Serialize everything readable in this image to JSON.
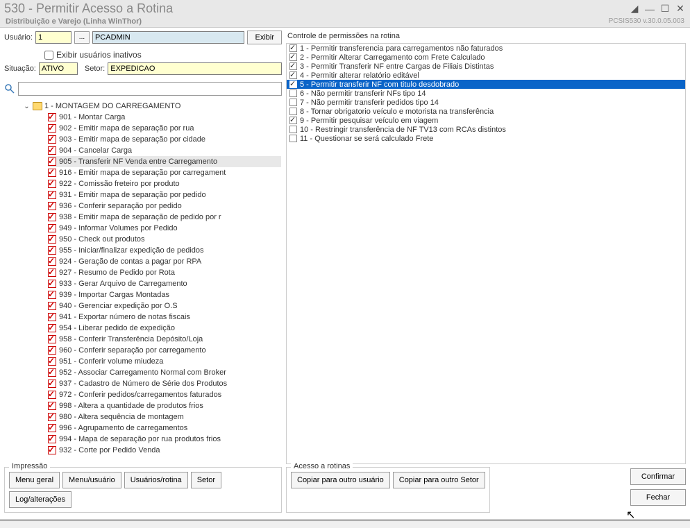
{
  "window": {
    "title": "530 - Permitir Acesso a Rotina",
    "subtitle": "Distribuição e Varejo (Linha WinThor)",
    "version_label": "PCSIS530   v.30.0.05.003"
  },
  "form": {
    "usuario_label": "Usuário:",
    "usuario_id": "1",
    "browse": "...",
    "usuario_name": "PCADMIN",
    "exibir_btn": "Exibir",
    "inativos_label": "Exibir usuários inativos",
    "situacao_label": "Situação:",
    "situacao_value": "ATIVO",
    "setor_label": "Setor:",
    "setor_value": "EXPEDICAO"
  },
  "tree": {
    "parent_label": "1 - MONTAGEM DO CARREGAMENTO",
    "items": [
      {
        "label": "901 - Montar Carga",
        "checked": true
      },
      {
        "label": "902 - Emitir mapa de separação por rua",
        "checked": true
      },
      {
        "label": "903 - Emitir mapa de separação por cidade",
        "checked": true
      },
      {
        "label": "904 - Cancelar Carga",
        "checked": true
      },
      {
        "label": "905 - Transferir NF Venda entre Carregamento",
        "checked": true,
        "selected": true
      },
      {
        "label": "916 - Emitir mapa de separação por carregament",
        "checked": true
      },
      {
        "label": "922 - Comissão freteiro por produto",
        "checked": true
      },
      {
        "label": "931 - Emitir mapa de separação por pedido",
        "checked": true
      },
      {
        "label": "936 - Conferir separação por pedido",
        "checked": true
      },
      {
        "label": "938 - Emitir mapa de separação de pedido por r",
        "checked": true
      },
      {
        "label": "949 - Informar Volumes por Pedido",
        "checked": true
      },
      {
        "label": "950 - Check out produtos",
        "checked": true
      },
      {
        "label": "955 - Iniciar/finalizar expedição de pedidos",
        "checked": true
      },
      {
        "label": "924 - Geração de contas a pagar por RPA",
        "checked": true
      },
      {
        "label": "927 - Resumo de Pedido por Rota",
        "checked": true
      },
      {
        "label": "933 - Gerar Arquivo de Carregamento",
        "checked": true
      },
      {
        "label": "939 - Importar Cargas Montadas",
        "checked": true
      },
      {
        "label": "940 - Gerenciar expedição por O.S",
        "checked": true
      },
      {
        "label": "941 - Exportar número de notas fiscais",
        "checked": true
      },
      {
        "label": "954 - Liberar pedido de expedição",
        "checked": true
      },
      {
        "label": "958 - Conferir Transferência Depósito/Loja",
        "checked": true
      },
      {
        "label": "960 - Conferir separação por carregamento",
        "checked": true
      },
      {
        "label": "951 - Conferir volume miudeza",
        "checked": true
      },
      {
        "label": "952 - Associar Carregamento Normal com Broker",
        "checked": true
      },
      {
        "label": "937 - Cadastro de Número de Série dos Produtos",
        "checked": true
      },
      {
        "label": "972 - Conferir pedidos/carregamentos faturados",
        "checked": true
      },
      {
        "label": "998 - Altera a quantidade de produtos frios",
        "checked": true
      },
      {
        "label": "980 - Altera sequência de montagem",
        "checked": true
      },
      {
        "label": "996 - Agrupamento de carregamentos",
        "checked": true
      },
      {
        "label": "994 - Mapa de separação por rua produtos frios",
        "checked": true
      },
      {
        "label": "932 - Corte por Pedido Venda",
        "checked": true
      }
    ]
  },
  "perms": {
    "header": "Controle de permissões na rotina",
    "items": [
      {
        "label": "1 - Permitir transferencia para carregamentos não faturados",
        "checked": true
      },
      {
        "label": "2 - Permitir Alterar Carregamento com Frete Calculado",
        "checked": true
      },
      {
        "label": "3 - Permitir Transferir NF entre Cargas de Filiais Distintas",
        "checked": true
      },
      {
        "label": "4 - Permitir alterar relatório editável",
        "checked": true
      },
      {
        "label": "5 - Permitir transferir NF com titulo desdobrado",
        "checked": true,
        "selected": true
      },
      {
        "label": "6 - Não permitir transferir NFs tipo 14",
        "checked": false
      },
      {
        "label": "7 - Não permitir transferir pedidos tipo 14",
        "checked": false
      },
      {
        "label": "8 - Tornar obrigatorio veículo e motorista na transferência",
        "checked": false
      },
      {
        "label": "9 - Permitir pesquisar veículo em viagem",
        "checked": true
      },
      {
        "label": "10 - Restringir transferência de NF TV13 com RCAs distintos",
        "checked": false
      },
      {
        "label": "11 - Questionar se será calculado Frete",
        "checked": false
      }
    ]
  },
  "bottom": {
    "impressao_legend": "Impressão",
    "acesso_legend": "Acesso a rotinas",
    "buttons": {
      "menu_geral": "Menu geral",
      "menu_usuario": "Menu/usuário",
      "usuarios_rotina": "Usuários/rotina",
      "setor": "Setor",
      "log": "Log/alterações",
      "copiar_usuario": "Copiar para outro usuário",
      "copiar_setor": "Copiar para outro Setor",
      "confirmar": "Confirmar",
      "fechar": "Fechar"
    }
  }
}
